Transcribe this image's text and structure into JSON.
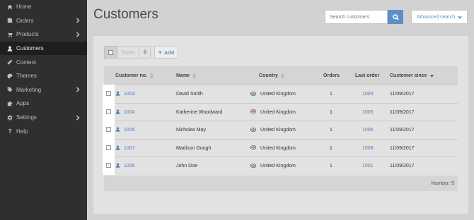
{
  "sidebar": {
    "items": [
      {
        "label": "Home",
        "icon": "home-icon",
        "has_submenu": false,
        "active": false
      },
      {
        "label": "Orders",
        "icon": "orders-icon",
        "has_submenu": true,
        "active": false
      },
      {
        "label": "Products",
        "icon": "cart-icon",
        "has_submenu": true,
        "active": false
      },
      {
        "label": "Customers",
        "icon": "user-icon",
        "has_submenu": false,
        "active": true
      },
      {
        "label": "Content",
        "icon": "pencil-icon",
        "has_submenu": false,
        "active": false
      },
      {
        "label": "Themes",
        "icon": "palette-icon",
        "has_submenu": false,
        "active": false
      },
      {
        "label": "Marketing",
        "icon": "tag-icon",
        "has_submenu": true,
        "active": false
      },
      {
        "label": "Apps",
        "icon": "puzzle-icon",
        "has_submenu": false,
        "active": false
      },
      {
        "label": "Settings",
        "icon": "gear-icon",
        "has_submenu": true,
        "active": false
      },
      {
        "label": "Help",
        "icon": "question-icon",
        "has_submenu": false,
        "active": false
      }
    ]
  },
  "header": {
    "title": "Customers",
    "search_placeholder": "Search customers",
    "advanced_search_label": "Advanced search"
  },
  "toolbar": {
    "export_label": "Export",
    "add_label": "Add"
  },
  "table": {
    "columns": [
      "Customer no.",
      "Name",
      "Country",
      "Orders",
      "Last order",
      "Customer since"
    ],
    "rows": [
      {
        "customer_no": "1003",
        "name": "David Smith",
        "country": "United Kingdom",
        "orders": "1",
        "last_order": "1004",
        "customer_since": "11/09/2017"
      },
      {
        "customer_no": "1004",
        "name": "Katherine Woodward",
        "country": "United Kingdom",
        "orders": "1",
        "last_order": "1005",
        "customer_since": "11/09/2017"
      },
      {
        "customer_no": "1005",
        "name": "Nicholas May",
        "country": "United Kingdom",
        "orders": "1",
        "last_order": "1006",
        "customer_since": "11/09/2017"
      },
      {
        "customer_no": "1007",
        "name": "Madison Gough",
        "country": "United Kingdom",
        "orders": "1",
        "last_order": "1008",
        "customer_since": "11/09/2017"
      },
      {
        "customer_no": "1006",
        "name": "John Doe",
        "country": "United Kingdom",
        "orders": "1",
        "last_order": "1001",
        "customer_since": "11/09/2017"
      }
    ],
    "footer_count": "Number: 5"
  },
  "colors": {
    "sidebar_bg": "#2f2f2f",
    "accent": "#5b8fc7",
    "link": "#4a7fb9"
  }
}
